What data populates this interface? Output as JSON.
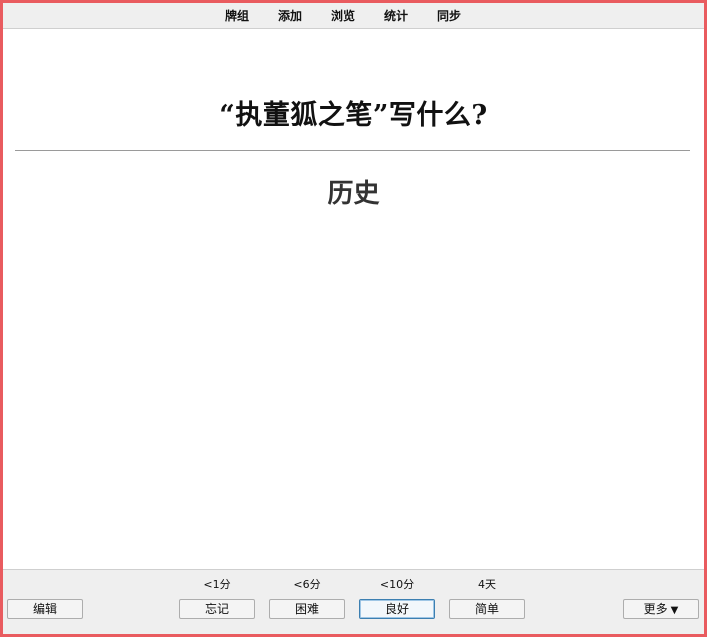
{
  "menu": {
    "items": [
      "牌组",
      "添加",
      "浏览",
      "统计",
      "同步"
    ]
  },
  "card": {
    "question": "“执董狐之笔”写什么?",
    "answer": "历史"
  },
  "bottom": {
    "edit_label": "编辑",
    "more_label": "更多",
    "more_arrow": "▼",
    "answers": [
      {
        "interval": "<1分",
        "label": "忘记"
      },
      {
        "interval": "<6分",
        "label": "困难"
      },
      {
        "interval": "<10分",
        "label": "良好"
      },
      {
        "interval": "4天",
        "label": "简单"
      }
    ]
  },
  "colors": {
    "window_border": "#e95b5f",
    "bar_background": "#efefef",
    "selected_border": "#3c7fb1"
  }
}
